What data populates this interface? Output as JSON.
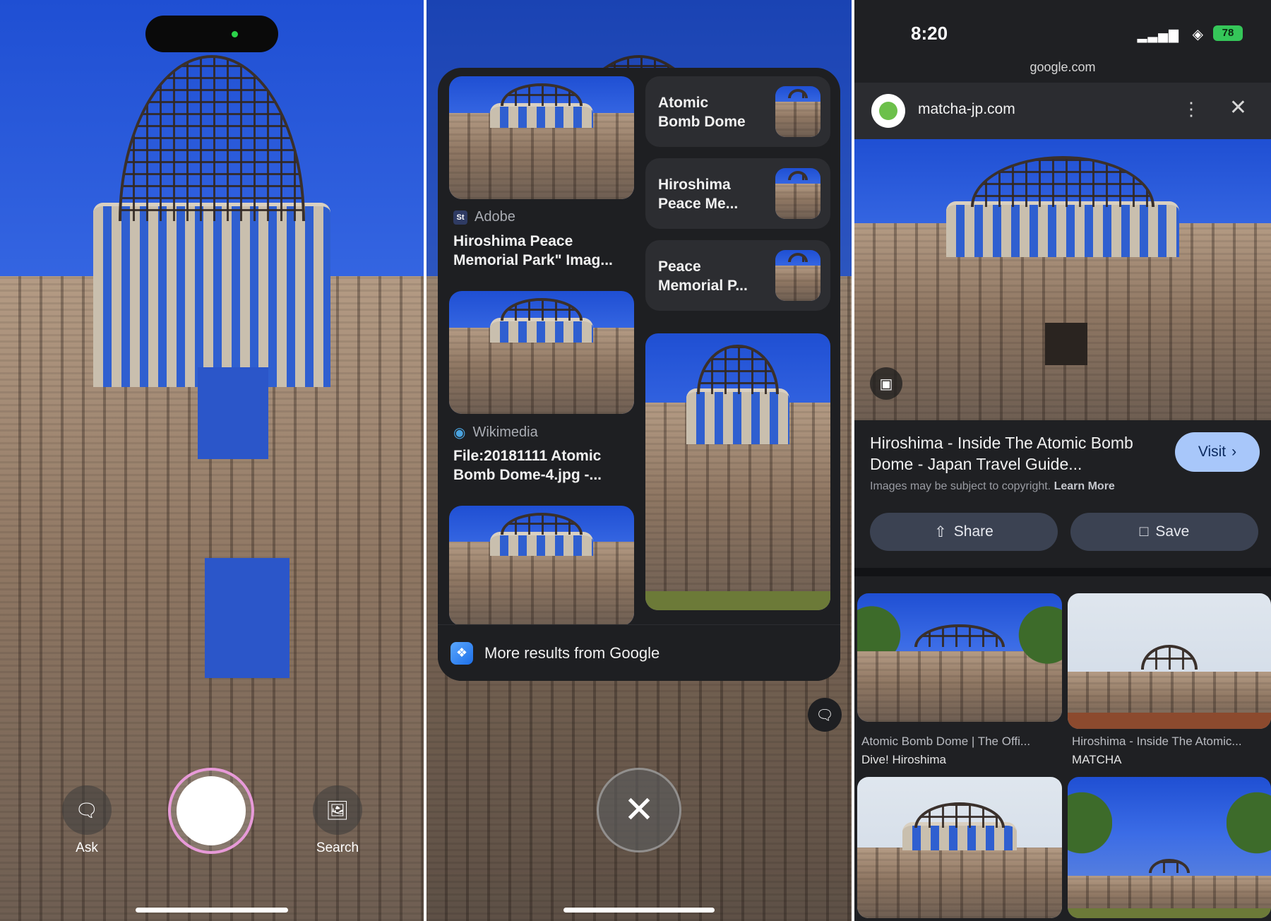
{
  "camera": {
    "ask_label": "Ask",
    "search_label": "Search"
  },
  "results": {
    "cards": [
      {
        "source": "Adobe",
        "source_icon": "St",
        "title_line1": "Hiroshima Peace",
        "title_line2": "Memorial Park\" Imag..."
      },
      {
        "source": "Wikimedia",
        "title_line1": "File:20181111 Atomic",
        "title_line2": "Bomb Dome-4.jpg -..."
      }
    ],
    "chips": [
      {
        "line1": "Atomic",
        "line2": "Bomb Dome"
      },
      {
        "line1": "Hiroshima",
        "line2": "Peace Me..."
      },
      {
        "line1": "Peace",
        "line2": "Memorial P..."
      }
    ],
    "more_label": "More results from Google"
  },
  "viewer": {
    "status": {
      "time": "8:20",
      "battery": "78"
    },
    "url": "google.com",
    "site": "matcha-jp.com",
    "title_line1": "Hiroshima - Inside The Atomic Bomb",
    "title_line2": "Dome - Japan Travel Guide...",
    "visit_label": "Visit",
    "copyright_text": "Images may be subject to copyright.",
    "learn_more": "Learn More",
    "share_label": "Share",
    "save_label": "Save",
    "grid": [
      {
        "caption": "Atomic Bomb Dome | The Offi...",
        "source": "Dive! Hiroshima"
      },
      {
        "caption": "Hiroshima - Inside The Atomic...",
        "source": "MATCHA"
      }
    ]
  }
}
